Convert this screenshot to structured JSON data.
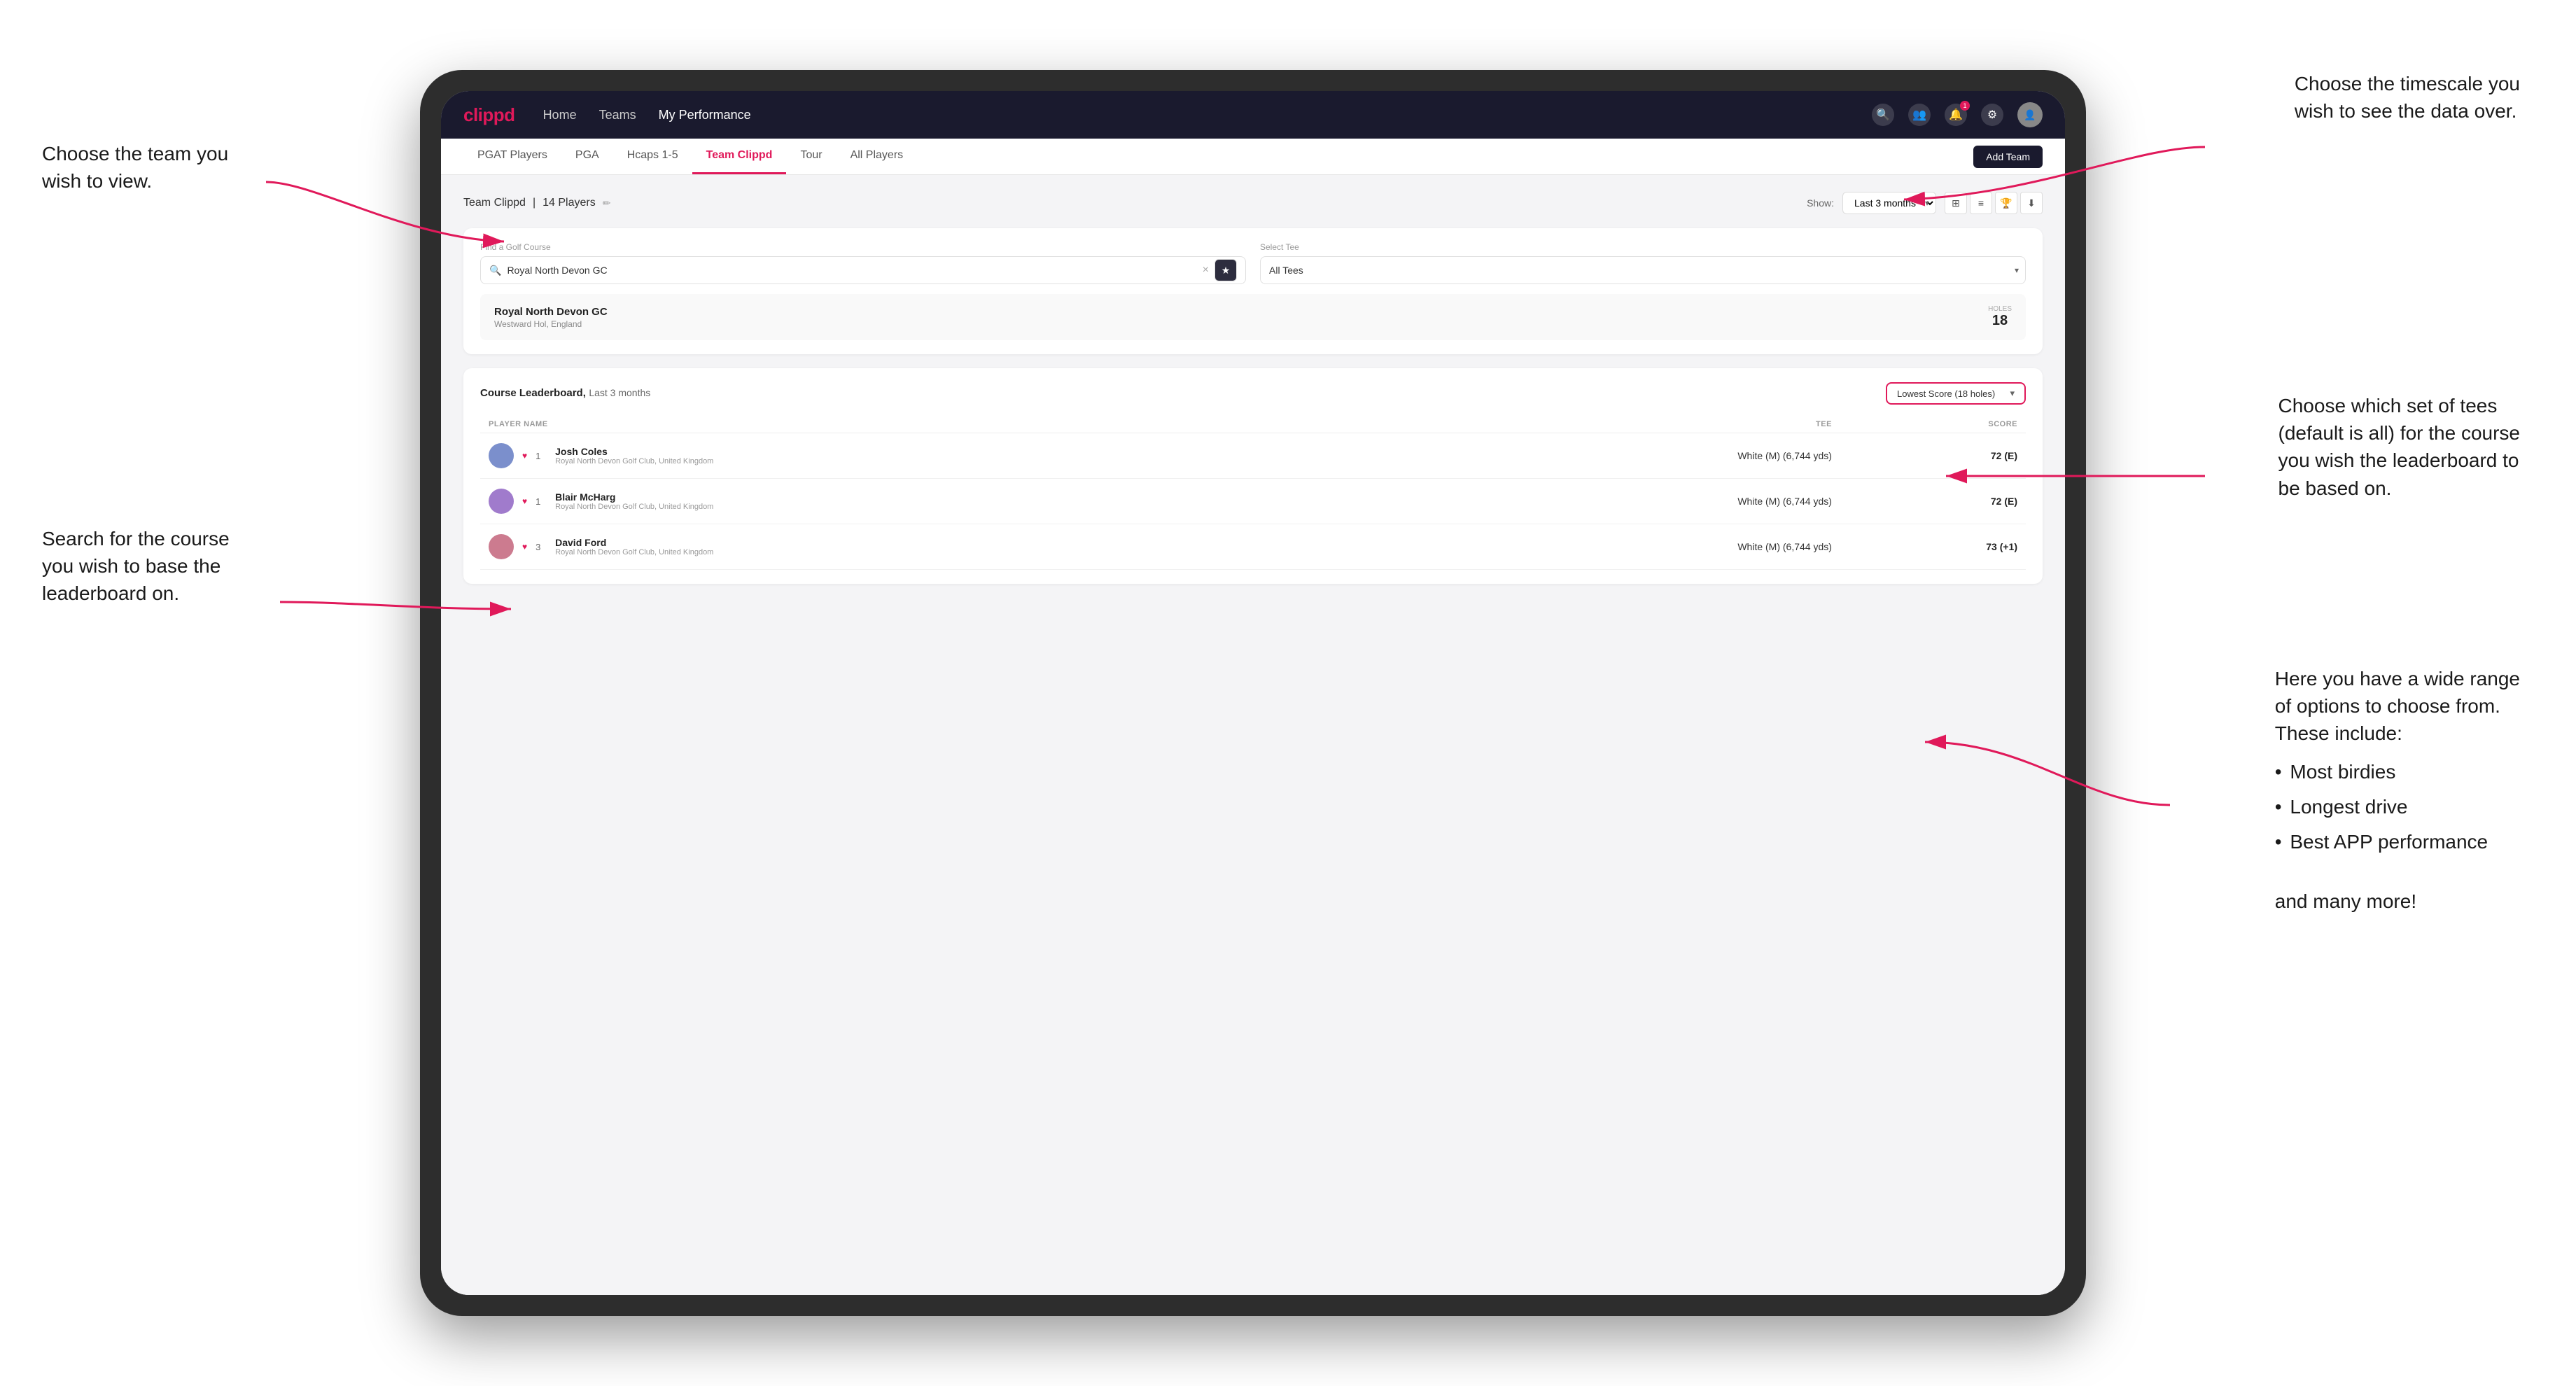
{
  "annotations": {
    "top_left": {
      "line1": "Choose the team you",
      "line2": "wish to view."
    },
    "mid_left": {
      "line1": "Search for the course",
      "line2": "you wish to base the",
      "line3": "leaderboard on."
    },
    "top_right": {
      "line1": "Choose the timescale you",
      "line2": "wish to see the data over."
    },
    "mid_right": {
      "line1": "Choose which set of tees",
      "line2": "(default is all) for the course",
      "line3": "you wish the leaderboard to",
      "line4": "be based on."
    },
    "bottom_right": {
      "intro": "Here you have a wide range",
      "line2": "of options to choose from.",
      "line3": "These include:",
      "bullets": [
        "Most birdies",
        "Longest drive",
        "Best APP performance"
      ],
      "footer": "and many more!"
    }
  },
  "navbar": {
    "brand": "clippd",
    "links": [
      "Home",
      "Teams",
      "My Performance"
    ],
    "active_link": "My Performance"
  },
  "sub_nav": {
    "tabs": [
      "PGAT Players",
      "PGA",
      "Hcaps 1-5",
      "Team Clippd",
      "Tour",
      "All Players"
    ],
    "active_tab": "Team Clippd",
    "add_team_btn": "Add Team"
  },
  "team_header": {
    "title": "Team Clippd",
    "player_count": "14 Players",
    "show_label": "Show:",
    "time_period": "Last 3 months"
  },
  "search": {
    "label": "Find a Golf Course",
    "placeholder": "Royal North Devon GC",
    "tee_label": "Select Tee",
    "tee_value": "All Tees"
  },
  "course_result": {
    "name": "Royal North Devon GC",
    "location": "Westward Hol, England",
    "holes_label": "Holes",
    "holes_value": "18"
  },
  "leaderboard": {
    "title": "Course Leaderboard,",
    "period": "Last 3 months",
    "score_type": "Lowest Score (18 holes)",
    "columns": {
      "player": "PLAYER NAME",
      "tee": "TEE",
      "score": "SCORE"
    },
    "rows": [
      {
        "rank": "1",
        "name": "Josh Coles",
        "club": "Royal North Devon Golf Club, United Kingdom",
        "tee": "White (M) (6,744 yds)",
        "score": "72 (E)"
      },
      {
        "rank": "1",
        "name": "Blair McHarg",
        "club": "Royal North Devon Golf Club, United Kingdom",
        "tee": "White (M) (6,744 yds)",
        "score": "72 (E)"
      },
      {
        "rank": "3",
        "name": "David Ford",
        "club": "Royal North Devon Golf Club, United Kingdom",
        "tee": "White (M) (6,744 yds)",
        "score": "73 (+1)"
      }
    ]
  }
}
